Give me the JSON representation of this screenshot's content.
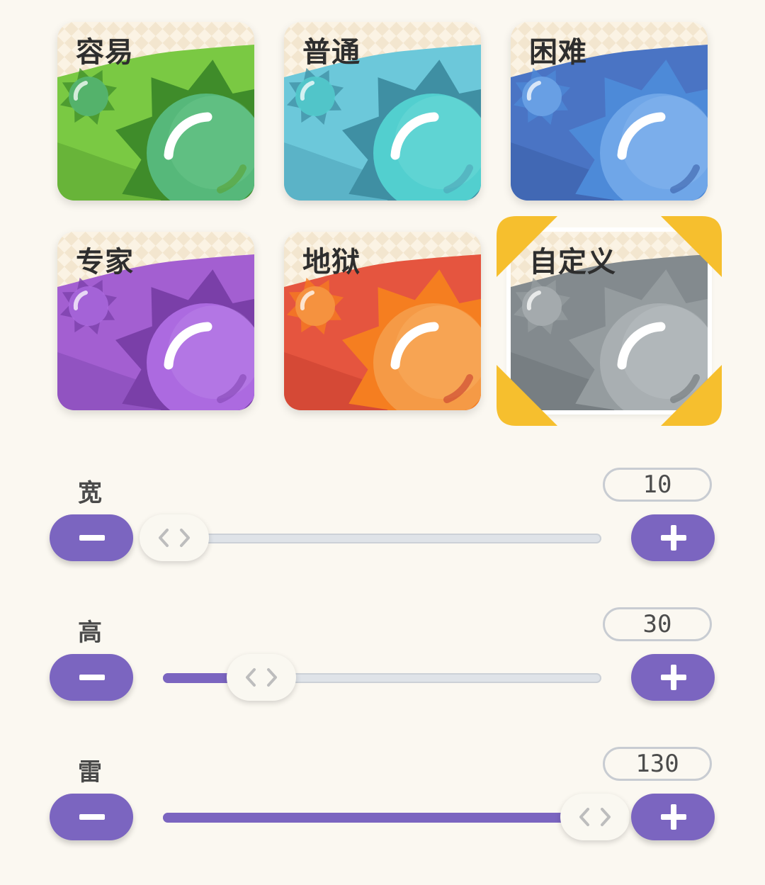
{
  "difficulties": [
    {
      "label": "容易",
      "dark": "#5aa232",
      "mid": "#7ac943",
      "ball": "#56b87a",
      "ballHi": "#7fd39b",
      "spike": "#3f8c2a",
      "sel": false
    },
    {
      "label": "普通",
      "dark": "#4ea3b8",
      "mid": "#6cc8da",
      "ball": "#52cfcf",
      "ballHi": "#86e3e0",
      "spike": "#3f8fa3",
      "sel": false
    },
    {
      "label": "困难",
      "dark": "#3a5fa8",
      "mid": "#4a74c4",
      "ball": "#6fa6e8",
      "ballHi": "#a0c8f5",
      "spike": "#4d8ad8",
      "sel": false
    },
    {
      "label": "专家",
      "dark": "#8448b4",
      "mid": "#a35fd1",
      "ball": "#ac6ae0",
      "ballHi": "#c89af0",
      "spike": "#7a3fa8",
      "sel": false
    },
    {
      "label": "地狱",
      "dark": "#c8402f",
      "mid": "#e5553f",
      "ball": "#f59a46",
      "ballHi": "#ffc37a",
      "spike": "#f57e20",
      "sel": false
    },
    {
      "label": "自定义",
      "dark": "#6e7478",
      "mid": "#838a8e",
      "ball": "#a9afb2",
      "ballHi": "#cdd1d3",
      "spike": "#959c9f",
      "sel": true
    }
  ],
  "colors": {
    "accent": "#7b65c0",
    "selection": "#f6bf2e",
    "background": "#fbf8f1"
  },
  "sliders": [
    {
      "label": "宽",
      "value": "10",
      "fraction": 0.0
    },
    {
      "label": "高",
      "value": "30",
      "fraction": 0.207
    },
    {
      "label": "雷",
      "value": "130",
      "fraction": 1.0
    }
  ]
}
